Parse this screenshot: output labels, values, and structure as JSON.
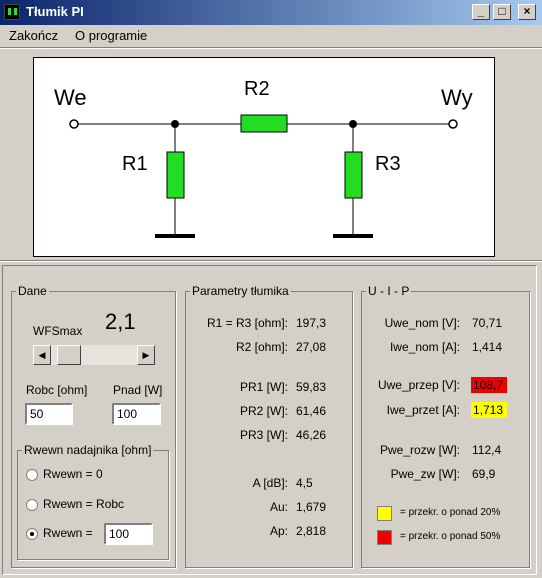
{
  "window": {
    "title": "Tłumik PI",
    "minimize": "_",
    "maximize": "□",
    "close": "×"
  },
  "menu": {
    "items": [
      "Zakończ",
      "O programie"
    ]
  },
  "circuit": {
    "input_label": "We",
    "output_label": "Wy",
    "r1": "R1",
    "r2": "R2",
    "r3": "R3",
    "resistor_color": "#22dd22"
  },
  "dane": {
    "title": "Dane",
    "wfs_label": "WFSmax",
    "wfs_value": "2,1",
    "wfs_slider_fraction": 0.1,
    "robc_label": "Robc [ohm]",
    "robc_value": "50",
    "pnad_label": "Pnad [W]",
    "pnad_value": "100",
    "rwewn_title": "Rwewn nadajnika [ohm]",
    "options": [
      "Rwewn = 0",
      "Rwewn = Robc",
      "Rwewn ="
    ],
    "selected_option": 2,
    "rwewn_value": "100"
  },
  "params": {
    "title": "Parametry tłumika",
    "rows": [
      {
        "label": "R1 = R3 [ohm]:",
        "value": "197,3"
      },
      {
        "label": "R2 [ohm]:",
        "value": "27,08"
      },
      {
        "label": "PR1 [W]:",
        "value": "59,83"
      },
      {
        "label": "PR2 [W]:",
        "value": "61,46"
      },
      {
        "label": "PR3 [W]:",
        "value": "46,26"
      },
      {
        "label": "A [dB]:",
        "value": "4,5"
      },
      {
        "label": "Au:",
        "value": "1,679"
      },
      {
        "label": "Ap:",
        "value": "2,818"
      }
    ]
  },
  "uip": {
    "title": "U - I - P",
    "rows": [
      {
        "label": "Uwe_nom [V]:",
        "value": "70,71"
      },
      {
        "label": "Iwe_nom [A]:",
        "value": "1,414"
      },
      {
        "label": "Uwe_przep [V]:",
        "value": "108,7"
      },
      {
        "label": "Iwe_przet [A]:",
        "value": "1,713"
      },
      {
        "label": "Pwe_rozw [W]:",
        "value": "112,4"
      },
      {
        "label": "Pwe_zw [W]:",
        "value": "69,9"
      }
    ],
    "warn_red": "#ee0000",
    "warn_yellow": "#ffff00",
    "legend": [
      {
        "color": "#ffff00",
        "text": "= przekr. o ponad 20%"
      },
      {
        "color": "#ee0000",
        "text": "= przekr. o ponad 50%"
      }
    ]
  }
}
